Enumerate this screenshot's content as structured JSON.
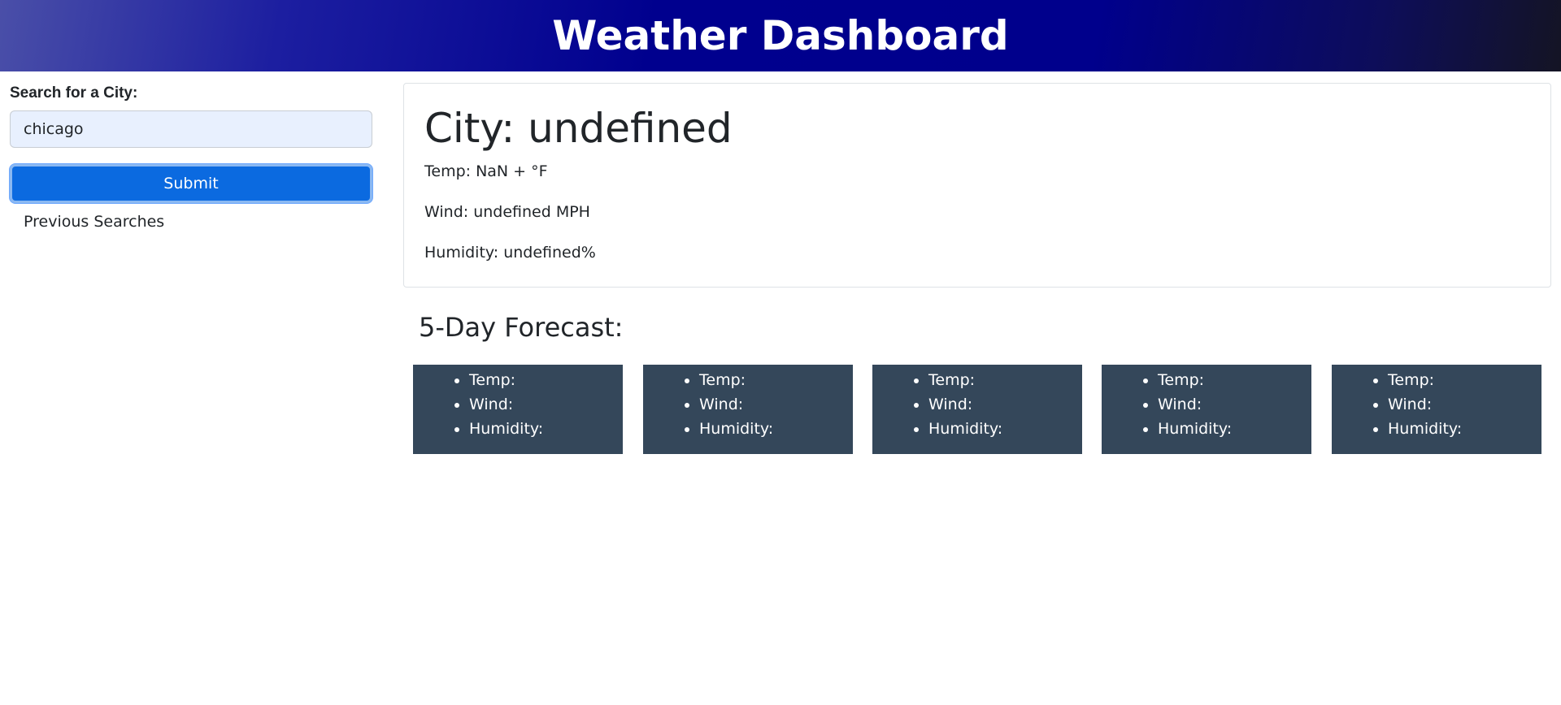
{
  "header": {
    "title": "Weather Dashboard"
  },
  "sidebar": {
    "search_label": "Search for a City:",
    "search_value": "chicago",
    "submit_label": "Submit",
    "previous_searches_label": "Previous Searches"
  },
  "current": {
    "city": "City: undefined",
    "temp": "Temp: NaN + °F",
    "wind": "Wind: undefined MPH",
    "humidity": "Humidity: undefined%"
  },
  "forecast": {
    "title": "5-Day Forecast:",
    "cards": [
      {
        "temp": "Temp:",
        "wind": "Wind:",
        "humidity": "Humidity:"
      },
      {
        "temp": "Temp:",
        "wind": "Wind:",
        "humidity": "Humidity:"
      },
      {
        "temp": "Temp:",
        "wind": "Wind:",
        "humidity": "Humidity:"
      },
      {
        "temp": "Temp:",
        "wind": "Wind:",
        "humidity": "Humidity:"
      },
      {
        "temp": "Temp:",
        "wind": "Wind:",
        "humidity": "Humidity:"
      }
    ]
  },
  "colors": {
    "header_bg": "#00008e",
    "button_bg": "#0b6ae0",
    "card_bg": "#34475a",
    "input_bg": "#e8f0fe"
  }
}
